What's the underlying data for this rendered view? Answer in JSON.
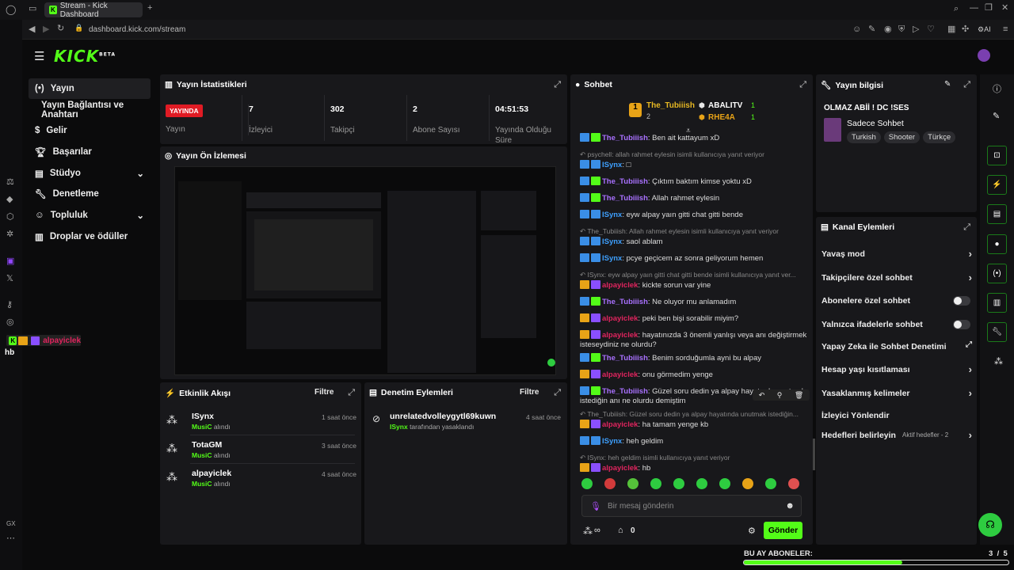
{
  "browser": {
    "tab_title": "Stream - Kick Dashboard",
    "url": "dashboard.kick.com/stream",
    "opera_logo": "opera-icon",
    "gx_label": "GX",
    "ai_label": "AI"
  },
  "brand": {
    "logo": "KICK",
    "beta": "BETA",
    "accent": "#53fc18"
  },
  "nav": {
    "items": [
      {
        "label": "Yayın",
        "icon": "broadcast-icon",
        "active": true
      },
      {
        "label": "Yayın Bağlantısı ve Anahtarı"
      },
      {
        "label": "Gelir",
        "icon": "revenue-icon"
      },
      {
        "label": "Başarılar",
        "icon": "trophy-icon"
      },
      {
        "label": "Stüdyo",
        "icon": "studio-icon"
      },
      {
        "label": "Denetleme",
        "icon": "wrench-icon"
      },
      {
        "label": "Topluluk",
        "icon": "community-icon"
      },
      {
        "label": "Droplar ve ödüller",
        "icon": "drops-icon"
      }
    ]
  },
  "overlay_chat": {
    "user": "alpayiclek",
    "message": "hb"
  },
  "stats": {
    "title": "Yayın İstatistikleri",
    "live_label": "YAYINDA",
    "live_caption": "Yayın",
    "viewers": "7",
    "viewers_label": "İzleyici",
    "followers": "302",
    "followers_label": "Takipçi",
    "subs": "2",
    "subs_label": "Abone Sayısı",
    "uptime": "04:51:53",
    "uptime_label": "Yayında Olduğu Süre"
  },
  "preview": {
    "title": "Yayın Ön İzlemesi"
  },
  "activity": {
    "title": "Etkinlik Akışı",
    "filter": "Filtre",
    "items": [
      {
        "name": "ISynx",
        "sub_b": "MusiC",
        "sub": "alındı",
        "time": "1 saat önce"
      },
      {
        "name": "TotaGM",
        "sub_b": "MusiC",
        "sub": "alındı",
        "time": "3 saat önce"
      },
      {
        "name": "alpayiclek",
        "sub_b": "MusiC",
        "sub": "alındı",
        "time": "4 saat önce"
      }
    ]
  },
  "moderation": {
    "title": "Denetim Eylemleri",
    "filter": "Filtre",
    "items": [
      {
        "name": "unrelatedvolleygytl69kuwn",
        "by": "ISynx",
        "action": "tarafından yasaklandı",
        "time": "4 saat önce"
      }
    ]
  },
  "chat": {
    "title": "Sohbet",
    "top": {
      "u1": "The_Tubiiish",
      "u1_count": "2",
      "u2": "ABALITV",
      "u2_count": "1",
      "u3": "RHE4A",
      "u3_count": "1"
    },
    "lines": [
      {
        "user": "The_Tubiiish",
        "color": "#a971ff",
        "text": "Ben ait kattayum xD",
        "badges": [
          "b-blue",
          "b-green"
        ]
      },
      {
        "reply": "psychell: allah rahmet eylesin isimli kullanıcıya yanıt veriyor"
      },
      {
        "user": "ISynx",
        "color": "#3ea0ff",
        "text": "□",
        "badges": [
          "b-blue",
          "b-blue"
        ]
      },
      {
        "user": "The_Tubiiish",
        "color": "#a971ff",
        "text": "Çıktım baktım kimse yoktu xD",
        "badges": [
          "b-blue",
          "b-green"
        ]
      },
      {
        "user": "The_Tubiiish",
        "color": "#a971ff",
        "text": "Allah rahmet eylesin",
        "badges": [
          "b-blue",
          "b-green"
        ]
      },
      {
        "user": "ISynx",
        "color": "#3ea0ff",
        "text": "eyw alpay yaın gitti chat gitti bende",
        "badges": [
          "b-blue",
          "b-blue"
        ]
      },
      {
        "reply": "The_Tubiiish: Allah rahmet eylesin isimli kullanıcıya yanıt veriyor"
      },
      {
        "user": "ISynx",
        "color": "#3ea0ff",
        "text": "saol ablam",
        "badges": [
          "b-blue",
          "b-blue"
        ]
      },
      {
        "user": "ISynx",
        "color": "#3ea0ff",
        "text": "pcye geçicem az sonra geliyorum hemen",
        "badges": [
          "b-blue",
          "b-blue"
        ]
      },
      {
        "reply": "ISynx: eyw alpay yaın gitti chat gitti bende isimli kullanıcıya yanıt ver..."
      },
      {
        "user": "alpayiclek",
        "color": "#e0245e",
        "text": "kickte sorun var yine",
        "badges": [
          "b-gold",
          "b-purple"
        ]
      },
      {
        "user": "The_Tubiiish",
        "color": "#a971ff",
        "text": "Ne oluyor mu anlamadım",
        "badges": [
          "b-blue",
          "b-green"
        ]
      },
      {
        "user": "alpayiclek",
        "color": "#e0245e",
        "text": "peki ben bişi sorabilir miyim?",
        "badges": [
          "b-gold",
          "b-purple"
        ]
      },
      {
        "user": "alpayiclek",
        "color": "#e0245e",
        "text": "hayatınızda 3 önemli yanlışı veya anı değiştirmek",
        "text2": "isteseydiniz ne olurdu?",
        "badges": [
          "b-gold",
          "b-purple"
        ]
      },
      {
        "user": "The_Tubiiish",
        "color": "#a971ff",
        "text": "Benim sorduğumla ayni bu alpay",
        "badges": [
          "b-blue",
          "b-green"
        ]
      },
      {
        "user": "alpayiclek",
        "color": "#e0245e",
        "text": "onu görmedim yenge",
        "badges": [
          "b-gold",
          "b-purple"
        ]
      },
      {
        "user": "The_Tubiiish",
        "color": "#a971ff",
        "text": "Güzel soru dedin ya alpay hayatında unutmak",
        "text2": "istediğin anı ne olurdu demiştim",
        "badges": [
          "b-blue",
          "b-green"
        ]
      },
      {
        "reply": "The_Tubiiish: Güzel soru dedin ya alpay hayatında unutmak istediğin..."
      },
      {
        "user": "alpayiclek",
        "color": "#e0245e",
        "text": "ha tamam yenge kb",
        "badges": [
          "b-gold",
          "b-purple"
        ]
      },
      {
        "user": "ISynx",
        "color": "#3ea0ff",
        "text": "heh geldim",
        "badges": [
          "b-blue",
          "b-blue"
        ]
      },
      {
        "reply": "ISynx: heh geldim isimli kullanıcıya yanıt veriyor"
      },
      {
        "user": "alpayiclek",
        "color": "#e0245e",
        "text": "hb",
        "badges": [
          "b-gold",
          "b-purple"
        ]
      }
    ],
    "input_placeholder": "Bir mesaj gönderin",
    "send": "Gönder",
    "points": "0"
  },
  "stream_info": {
    "title": "Yayın bilgisi",
    "stream_title": "OLMAZ ABİİ ! DC !SES",
    "category": "Sadece Sohbet",
    "tags": [
      "Turkish",
      "Shooter",
      "Türkçe"
    ]
  },
  "channel_actions": {
    "title": "Kanal Eylemleri",
    "items": [
      {
        "label": "Yavaş mod",
        "type": "chevron"
      },
      {
        "label": "Takipçilere özel sohbet",
        "type": "chevron"
      },
      {
        "label": "Abonelere özel sohbet",
        "type": "toggle"
      },
      {
        "label": "Yalnızca ifadelerle sohbet",
        "type": "toggle"
      },
      {
        "label": "Yapay Zeka ile Sohbet Denetimi",
        "type": "external"
      },
      {
        "label": "Hesap yaşı kısıtlaması",
        "type": "chevron"
      },
      {
        "label": "Yasaklanmış kelimeler",
        "type": "chevron"
      },
      {
        "label": "İzleyici Yönlendir",
        "type": "none"
      },
      {
        "label": "Hedefleri belirleyin",
        "type": "chevron",
        "extra": "Aktif hedefler - 2"
      }
    ]
  },
  "sub_goal": {
    "label": "BU AY ABONELER:",
    "current": "3",
    "sep": "/",
    "target": "5",
    "progress": 0.6
  }
}
